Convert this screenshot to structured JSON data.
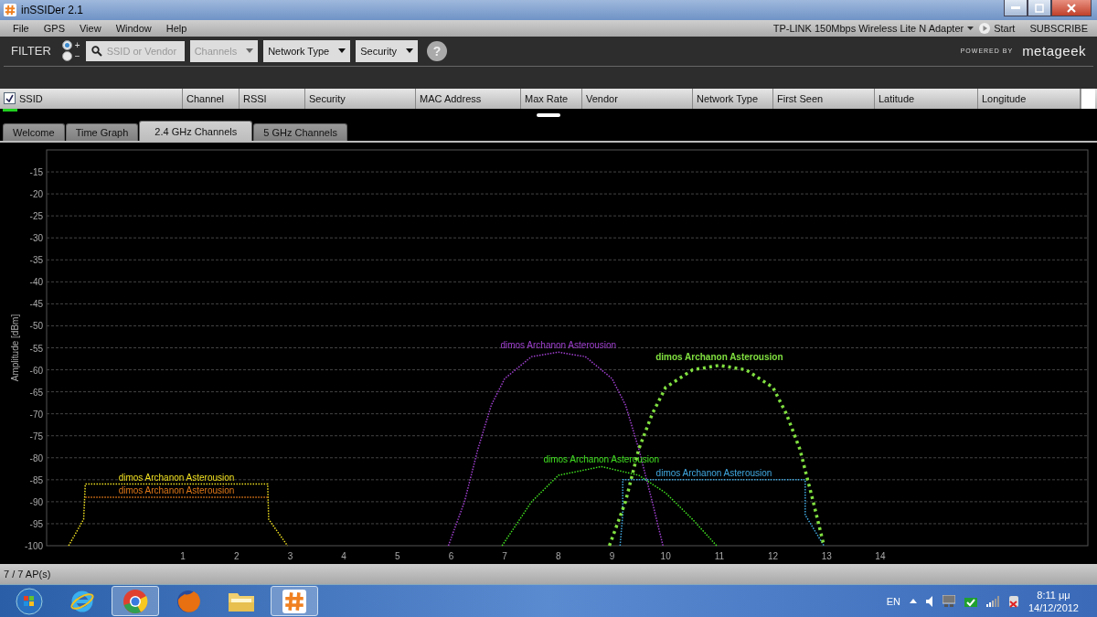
{
  "window": {
    "title": "inSSIDer 2.1"
  },
  "menu": [
    "File",
    "GPS",
    "View",
    "Window",
    "Help"
  ],
  "adapter": {
    "label": "TP-LINK 150Mbps Wireless Lite N Adapter",
    "start": "Start",
    "subscribe": "SUBSCRIBE"
  },
  "filter": {
    "label": "FILTER",
    "modes": [
      {
        "label": "+",
        "selected": true
      },
      {
        "label": "−",
        "selected": false
      }
    ],
    "search_placeholder": "SSID or Vendor",
    "dropdowns": [
      {
        "label": "Channels",
        "disabled": true
      },
      {
        "label": "Network Type",
        "disabled": false
      },
      {
        "label": "Security",
        "disabled": false
      }
    ],
    "help": "?"
  },
  "branding": {
    "powered_by": "POWERED BY",
    "logo": "metageek"
  },
  "table": {
    "all_checked": true,
    "columns": [
      "SSID",
      "Channel",
      "RSSI",
      "Security",
      "MAC Address",
      "Max Rate",
      "Vendor",
      "Network Type",
      "First Seen",
      "Latitude",
      "Longitude"
    ]
  },
  "tabs": [
    {
      "label": "Welcome",
      "selected": false
    },
    {
      "label": "Time Graph",
      "selected": false
    },
    {
      "label": "2.4 GHz Channels",
      "selected": true
    },
    {
      "label": "5 GHz Channels",
      "selected": false
    }
  ],
  "chart_data": {
    "type": "line",
    "ylabel": "Amplitude [dBm]",
    "xlim": [
      -1.54,
      17.87
    ],
    "ylim": [
      -100,
      -10
    ],
    "grid": true,
    "xticks": [
      1,
      2,
      3,
      4,
      5,
      6,
      7,
      8,
      9,
      10,
      11,
      12,
      13,
      14
    ],
    "yticks": [
      -15,
      -20,
      -25,
      -30,
      -35,
      -40,
      -45,
      -50,
      -55,
      -60,
      -65,
      -70,
      -75,
      -80,
      -85,
      -90,
      -95,
      -100
    ],
    "series": [
      {
        "name": "dimos Archanon Asterousion",
        "color": "#f0e020",
        "line_style": "dotted",
        "x": [
          -1.13,
          -0.85,
          -0.82,
          2.58,
          2.6,
          2.95
        ],
        "values": [
          -100,
          -94,
          -86,
          -86,
          -94,
          -100
        ]
      },
      {
        "name": "dimos Archanon Asterousion",
        "color": "#e07818",
        "line_style": "dotted",
        "x": [
          -0.82,
          2.58
        ],
        "values": [
          -89,
          -89
        ]
      },
      {
        "name": "dimos Archanon Asterousion",
        "color": "#a040d0",
        "line_style": "dotted",
        "x": [
          5.95,
          6.25,
          6.5,
          6.75,
          7,
          7.5,
          8,
          8.5,
          9,
          9.25,
          9.5,
          9.75,
          9.95
        ],
        "values": [
          -100,
          -90,
          -78,
          -68,
          -62,
          -57,
          -56,
          -57,
          -62,
          -68,
          -78,
          -90,
          -100
        ]
      },
      {
        "name": "dimos Archanon Asterousion",
        "color": "#40e020",
        "line_style": "dotted",
        "x": [
          6.95,
          7.5,
          8,
          8.8,
          9.5,
          10,
          10.5,
          10.95
        ],
        "values": [
          -100,
          -90,
          -84,
          -82,
          -84,
          -88,
          -94,
          -100
        ]
      },
      {
        "name": "dimos Archanon Asterousion",
        "color": "#40a8e0",
        "line_style": "dotted",
        "x": [
          9.15,
          9.2,
          9.2,
          12.6,
          12.6,
          12.95
        ],
        "values": [
          -100,
          -93,
          -85,
          -85,
          -93,
          -100
        ]
      },
      {
        "name": "dimos Archanon Asterousion",
        "color": "#80e040",
        "line_style": "dashed",
        "x": [
          8.95,
          9.25,
          9.5,
          9.75,
          10,
          10.5,
          11,
          11.5,
          12,
          12.25,
          12.5,
          12.75,
          12.95
        ],
        "values": [
          -100,
          -90,
          -78,
          -70,
          -64,
          -60,
          -59,
          -60,
          -64,
          -70,
          -78,
          -90,
          -100
        ]
      }
    ]
  },
  "status_bar": "7 / 7 AP(s)",
  "taskbar": {
    "apps": [
      {
        "kind": "ie",
        "selected": false
      },
      {
        "kind": "chrome",
        "selected": true
      },
      {
        "kind": "firefox",
        "selected": false
      },
      {
        "kind": "folder",
        "selected": false
      },
      {
        "kind": "inssider",
        "selected": true
      }
    ],
    "tray": {
      "language": "EN",
      "time": "8:11 μμ",
      "date": "14/12/2012"
    }
  }
}
